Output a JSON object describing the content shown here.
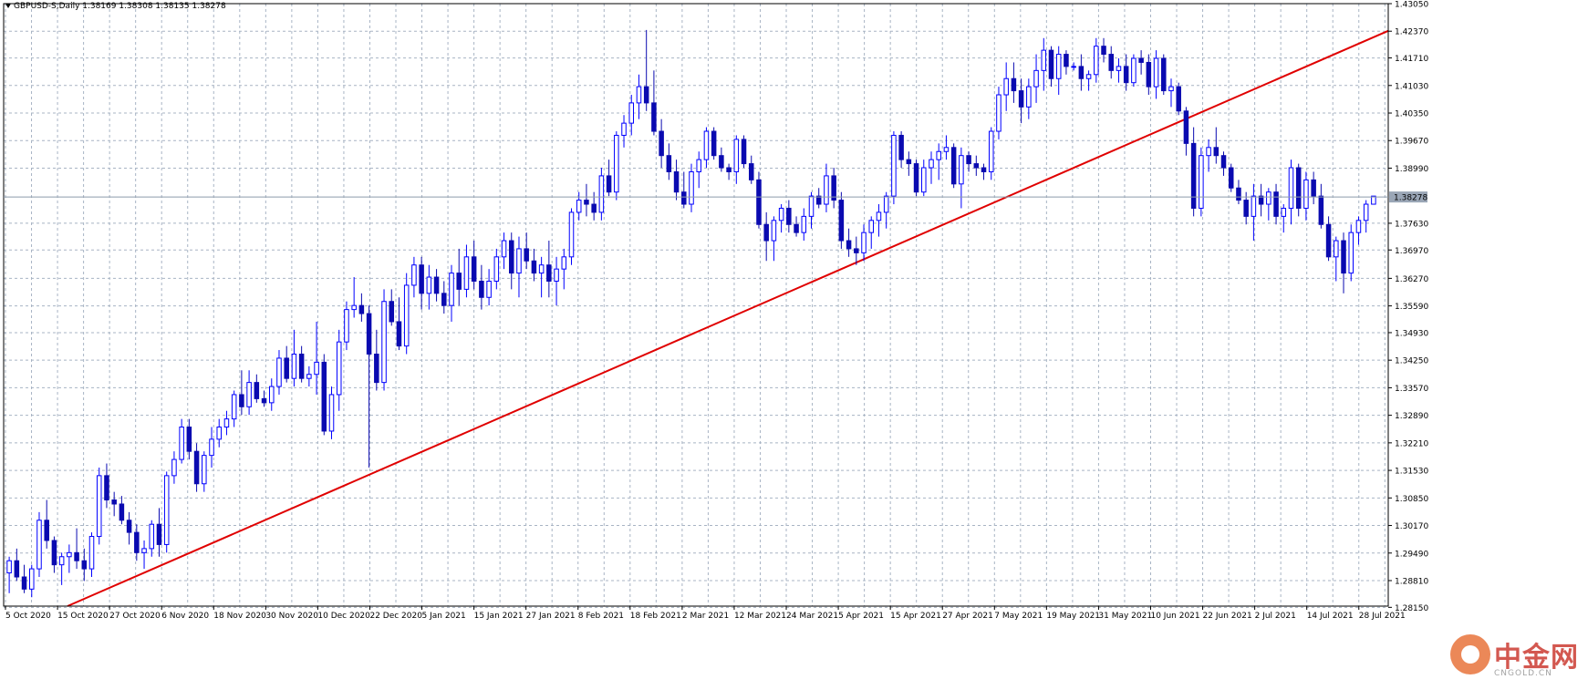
{
  "header": {
    "label": "GBPUSD-S,Daily  1.38169 1.38308 1.38135 1.38278"
  },
  "watermark": {
    "brand_cn": "中金网",
    "brand_en": "CNGOLD.CN"
  },
  "colors": {
    "grid": "#a8b4c4",
    "bull": "#0000ff",
    "bear": "#0a0ab0",
    "trendline": "#e00000",
    "bid_line": "#8c9aaa",
    "price_tag_bg": "#9aa6b6",
    "bg": "#ffffff"
  },
  "chart_data": {
    "type": "candlestick",
    "symbol": "GBPUSD-S",
    "timeframe": "Daily",
    "ohlc_label": [
      1.38169,
      1.38308,
      1.38135,
      1.38278
    ],
    "current_price": "1.38278",
    "ylim": [
      1.2818,
      1.4305
    ],
    "y_ticks": [
      "1.43050",
      "1.42370",
      "1.41710",
      "1.41030",
      "1.40350",
      "1.39670",
      "1.38990",
      "1.38278",
      "1.37630",
      "1.36970",
      "1.36270",
      "1.35590",
      "1.34930",
      "1.34250",
      "1.33570",
      "1.32890",
      "1.32210",
      "1.31530",
      "1.30850",
      "1.30170",
      "1.29490",
      "1.28810",
      "1.28150"
    ],
    "x_ticks": [
      "5 Oct 2020",
      "15 Oct 2020",
      "27 Oct 2020",
      "6 Nov 2020",
      "18 Nov 2020",
      "30 Nov 2020",
      "10 Dec 2020",
      "22 Dec 2020",
      "5 Jan 2021",
      "15 Jan 2021",
      "27 Jan 2021",
      "8 Feb 2021",
      "18 Feb 2021",
      "2 Mar 2021",
      "12 Mar 2021",
      "24 Mar 2021",
      "5 Apr 2021",
      "15 Apr 2021",
      "27 Apr 2021",
      "7 May 2021",
      "19 May 2021",
      "31 May 2021",
      "10 Jun 2021",
      "22 Jun 2021",
      "2 Jul 2021",
      "14 Jul 2021",
      "28 Jul 2021"
    ],
    "trendline": {
      "start": [
        "15 Oct 2020",
        1.2818
      ],
      "end": [
        "30 Jul 2021",
        1.4238
      ]
    },
    "candles": [
      [
        1.29,
        1.294,
        1.285,
        1.293
      ],
      [
        1.293,
        1.296,
        1.288,
        1.289
      ],
      [
        1.289,
        1.292,
        1.285,
        1.286
      ],
      [
        1.286,
        1.292,
        1.284,
        1.291
      ],
      [
        1.291,
        1.305,
        1.289,
        1.303
      ],
      [
        1.303,
        1.308,
        1.296,
        1.298
      ],
      [
        1.298,
        1.299,
        1.29,
        1.292
      ],
      [
        1.292,
        1.295,
        1.287,
        1.294
      ],
      [
        1.294,
        1.297,
        1.29,
        1.295
      ],
      [
        1.295,
        1.301,
        1.291,
        1.293
      ],
      [
        1.293,
        1.296,
        1.288,
        1.291
      ],
      [
        1.291,
        1.3,
        1.289,
        1.299
      ],
      [
        1.299,
        1.316,
        1.297,
        1.314
      ],
      [
        1.314,
        1.317,
        1.306,
        1.308
      ],
      [
        1.308,
        1.31,
        1.304,
        1.307
      ],
      [
        1.307,
        1.309,
        1.302,
        1.303
      ],
      [
        1.303,
        1.305,
        1.297,
        1.3
      ],
      [
        1.3,
        1.302,
        1.293,
        1.295
      ],
      [
        1.295,
        1.298,
        1.291,
        1.296
      ],
      [
        1.296,
        1.303,
        1.294,
        1.302
      ],
      [
        1.302,
        1.306,
        1.294,
        1.297
      ],
      [
        1.297,
        1.315,
        1.295,
        1.314
      ],
      [
        1.314,
        1.32,
        1.312,
        1.318
      ],
      [
        1.318,
        1.328,
        1.317,
        1.326
      ],
      [
        1.326,
        1.328,
        1.318,
        1.32
      ],
      [
        1.32,
        1.322,
        1.31,
        1.312
      ],
      [
        1.312,
        1.32,
        1.31,
        1.319
      ],
      [
        1.319,
        1.326,
        1.316,
        1.323
      ],
      [
        1.323,
        1.328,
        1.321,
        1.326
      ],
      [
        1.326,
        1.33,
        1.324,
        1.328
      ],
      [
        1.328,
        1.335,
        1.326,
        1.334
      ],
      [
        1.334,
        1.34,
        1.329,
        1.331
      ],
      [
        1.331,
        1.34,
        1.329,
        1.337
      ],
      [
        1.337,
        1.339,
        1.332,
        1.333
      ],
      [
        1.333,
        1.335,
        1.331,
        1.332
      ],
      [
        1.332,
        1.338,
        1.33,
        1.336
      ],
      [
        1.336,
        1.345,
        1.334,
        1.343
      ],
      [
        1.343,
        1.346,
        1.337,
        1.338
      ],
      [
        1.338,
        1.35,
        1.336,
        1.344
      ],
      [
        1.344,
        1.346,
        1.337,
        1.338
      ],
      [
        1.338,
        1.341,
        1.336,
        1.339
      ],
      [
        1.339,
        1.352,
        1.334,
        1.342
      ],
      [
        1.342,
        1.344,
        1.324,
        1.325
      ],
      [
        1.325,
        1.336,
        1.323,
        1.334
      ],
      [
        1.334,
        1.35,
        1.33,
        1.347
      ],
      [
        1.347,
        1.357,
        1.345,
        1.355
      ],
      [
        1.355,
        1.363,
        1.353,
        1.356
      ],
      [
        1.356,
        1.359,
        1.352,
        1.354
      ],
      [
        1.354,
        1.356,
        1.316,
        1.344
      ],
      [
        1.344,
        1.35,
        1.335,
        1.337
      ],
      [
        1.337,
        1.36,
        1.335,
        1.357
      ],
      [
        1.357,
        1.36,
        1.351,
        1.352
      ],
      [
        1.352,
        1.358,
        1.345,
        1.346
      ],
      [
        1.346,
        1.364,
        1.344,
        1.361
      ],
      [
        1.361,
        1.368,
        1.358,
        1.366
      ],
      [
        1.366,
        1.368,
        1.355,
        1.359
      ],
      [
        1.359,
        1.366,
        1.355,
        1.363
      ],
      [
        1.363,
        1.365,
        1.357,
        1.359
      ],
      [
        1.359,
        1.362,
        1.354,
        1.356
      ],
      [
        1.356,
        1.366,
        1.352,
        1.364
      ],
      [
        1.364,
        1.37,
        1.356,
        1.36
      ],
      [
        1.36,
        1.371,
        1.358,
        1.368
      ],
      [
        1.368,
        1.372,
        1.36,
        1.362
      ],
      [
        1.362,
        1.366,
        1.355,
        1.358
      ],
      [
        1.358,
        1.365,
        1.356,
        1.362
      ],
      [
        1.362,
        1.37,
        1.36,
        1.368
      ],
      [
        1.368,
        1.374,
        1.365,
        1.372
      ],
      [
        1.372,
        1.374,
        1.36,
        1.364
      ],
      [
        1.364,
        1.373,
        1.358,
        1.37
      ],
      [
        1.37,
        1.374,
        1.365,
        1.367
      ],
      [
        1.367,
        1.37,
        1.362,
        1.364
      ],
      [
        1.364,
        1.368,
        1.358,
        1.366
      ],
      [
        1.366,
        1.372,
        1.358,
        1.362
      ],
      [
        1.362,
        1.368,
        1.356,
        1.365
      ],
      [
        1.365,
        1.37,
        1.36,
        1.368
      ],
      [
        1.368,
        1.38,
        1.366,
        1.379
      ],
      [
        1.379,
        1.384,
        1.377,
        1.382
      ],
      [
        1.382,
        1.386,
        1.378,
        1.381
      ],
      [
        1.381,
        1.384,
        1.377,
        1.379
      ],
      [
        1.379,
        1.39,
        1.377,
        1.388
      ],
      [
        1.388,
        1.392,
        1.383,
        1.384
      ],
      [
        1.384,
        1.399,
        1.382,
        1.398
      ],
      [
        1.398,
        1.403,
        1.395,
        1.401
      ],
      [
        1.401,
        1.408,
        1.398,
        1.406
      ],
      [
        1.406,
        1.413,
        1.402,
        1.41
      ],
      [
        1.41,
        1.424,
        1.404,
        1.406
      ],
      [
        1.406,
        1.414,
        1.398,
        1.399
      ],
      [
        1.399,
        1.402,
        1.39,
        1.393
      ],
      [
        1.393,
        1.396,
        1.387,
        1.389
      ],
      [
        1.389,
        1.392,
        1.382,
        1.384
      ],
      [
        1.384,
        1.389,
        1.38,
        1.381
      ],
      [
        1.381,
        1.391,
        1.379,
        1.389
      ],
      [
        1.389,
        1.394,
        1.385,
        1.392
      ],
      [
        1.392,
        1.4,
        1.39,
        1.399
      ],
      [
        1.399,
        1.4,
        1.392,
        1.393
      ],
      [
        1.393,
        1.395,
        1.389,
        1.39
      ],
      [
        1.39,
        1.391,
        1.387,
        1.389
      ],
      [
        1.389,
        1.398,
        1.386,
        1.397
      ],
      [
        1.397,
        1.398,
        1.39,
        1.391
      ],
      [
        1.391,
        1.393,
        1.386,
        1.387
      ],
      [
        1.387,
        1.389,
        1.375,
        1.376
      ],
      [
        1.376,
        1.379,
        1.367,
        1.372
      ],
      [
        1.372,
        1.378,
        1.367,
        1.377
      ],
      [
        1.377,
        1.381,
        1.374,
        1.38
      ],
      [
        1.38,
        1.382,
        1.374,
        1.376
      ],
      [
        1.376,
        1.378,
        1.373,
        1.374
      ],
      [
        1.374,
        1.38,
        1.372,
        1.378
      ],
      [
        1.378,
        1.384,
        1.375,
        1.383
      ],
      [
        1.383,
        1.385,
        1.38,
        1.381
      ],
      [
        1.381,
        1.391,
        1.379,
        1.388
      ],
      [
        1.388,
        1.39,
        1.38,
        1.382
      ],
      [
        1.382,
        1.384,
        1.37,
        1.372
      ],
      [
        1.372,
        1.375,
        1.368,
        1.37
      ],
      [
        1.37,
        1.373,
        1.366,
        1.369
      ],
      [
        1.369,
        1.376,
        1.367,
        1.374
      ],
      [
        1.374,
        1.378,
        1.37,
        1.377
      ],
      [
        1.377,
        1.381,
        1.373,
        1.379
      ],
      [
        1.379,
        1.384,
        1.375,
        1.383
      ],
      [
        1.383,
        1.399,
        1.381,
        1.398
      ],
      [
        1.398,
        1.399,
        1.39,
        1.392
      ],
      [
        1.392,
        1.394,
        1.388,
        1.391
      ],
      [
        1.391,
        1.392,
        1.383,
        1.384
      ],
      [
        1.384,
        1.392,
        1.383,
        1.39
      ],
      [
        1.39,
        1.394,
        1.386,
        1.392
      ],
      [
        1.392,
        1.396,
        1.387,
        1.394
      ],
      [
        1.394,
        1.398,
        1.392,
        1.395
      ],
      [
        1.395,
        1.396,
        1.385,
        1.386
      ],
      [
        1.386,
        1.395,
        1.38,
        1.393
      ],
      [
        1.393,
        1.394,
        1.389,
        1.391
      ],
      [
        1.391,
        1.393,
        1.388,
        1.39
      ],
      [
        1.39,
        1.391,
        1.387,
        1.389
      ],
      [
        1.389,
        1.4,
        1.387,
        1.399
      ],
      [
        1.399,
        1.41,
        1.397,
        1.408
      ],
      [
        1.408,
        1.416,
        1.404,
        1.412
      ],
      [
        1.412,
        1.416,
        1.406,
        1.409
      ],
      [
        1.409,
        1.412,
        1.401,
        1.405
      ],
      [
        1.405,
        1.412,
        1.402,
        1.41
      ],
      [
        1.41,
        1.418,
        1.406,
        1.414
      ],
      [
        1.414,
        1.422,
        1.409,
        1.419
      ],
      [
        1.419,
        1.42,
        1.41,
        1.412
      ],
      [
        1.412,
        1.42,
        1.408,
        1.418
      ],
      [
        1.418,
        1.419,
        1.413,
        1.415
      ],
      [
        1.415,
        1.416,
        1.414,
        1.415
      ],
      [
        1.415,
        1.418,
        1.409,
        1.412
      ],
      [
        1.412,
        1.414,
        1.409,
        1.413
      ],
      [
        1.413,
        1.422,
        1.411,
        1.42
      ],
      [
        1.42,
        1.422,
        1.416,
        1.418
      ],
      [
        1.418,
        1.42,
        1.412,
        1.414
      ],
      [
        1.414,
        1.417,
        1.411,
        1.415
      ],
      [
        1.415,
        1.418,
        1.409,
        1.411
      ],
      [
        1.411,
        1.418,
        1.41,
        1.417
      ],
      [
        1.417,
        1.419,
        1.413,
        1.416
      ],
      [
        1.416,
        1.418,
        1.408,
        1.41
      ],
      [
        1.41,
        1.419,
        1.407,
        1.417
      ],
      [
        1.417,
        1.418,
        1.408,
        1.409
      ],
      [
        1.409,
        1.412,
        1.405,
        1.41
      ],
      [
        1.41,
        1.411,
        1.403,
        1.404
      ],
      [
        1.404,
        1.405,
        1.393,
        1.396
      ],
      [
        1.396,
        1.4,
        1.378,
        1.38
      ],
      [
        1.38,
        1.395,
        1.378,
        1.393
      ],
      [
        1.393,
        1.397,
        1.389,
        1.395
      ],
      [
        1.395,
        1.4,
        1.391,
        1.393
      ],
      [
        1.393,
        1.394,
        1.388,
        1.39
      ],
      [
        1.39,
        1.391,
        1.384,
        1.385
      ],
      [
        1.385,
        1.387,
        1.381,
        1.382
      ],
      [
        1.382,
        1.384,
        1.376,
        1.378
      ],
      [
        1.378,
        1.386,
        1.372,
        1.383
      ],
      [
        1.383,
        1.386,
        1.378,
        1.381
      ],
      [
        1.381,
        1.385,
        1.377,
        1.384
      ],
      [
        1.384,
        1.386,
        1.376,
        1.378
      ],
      [
        1.378,
        1.381,
        1.374,
        1.38
      ],
      [
        1.38,
        1.392,
        1.376,
        1.39
      ],
      [
        1.39,
        1.391,
        1.378,
        1.38
      ],
      [
        1.38,
        1.389,
        1.377,
        1.387
      ],
      [
        1.387,
        1.389,
        1.381,
        1.383
      ],
      [
        1.383,
        1.386,
        1.375,
        1.376
      ],
      [
        1.376,
        1.378,
        1.367,
        1.368
      ],
      [
        1.368,
        1.373,
        1.362,
        1.372
      ],
      [
        1.372,
        1.374,
        1.359,
        1.364
      ],
      [
        1.364,
        1.376,
        1.362,
        1.374
      ],
      [
        1.374,
        1.378,
        1.371,
        1.377
      ],
      [
        1.377,
        1.382,
        1.374,
        1.381
      ],
      [
        1.381,
        1.383,
        1.381,
        1.383
      ]
    ]
  }
}
